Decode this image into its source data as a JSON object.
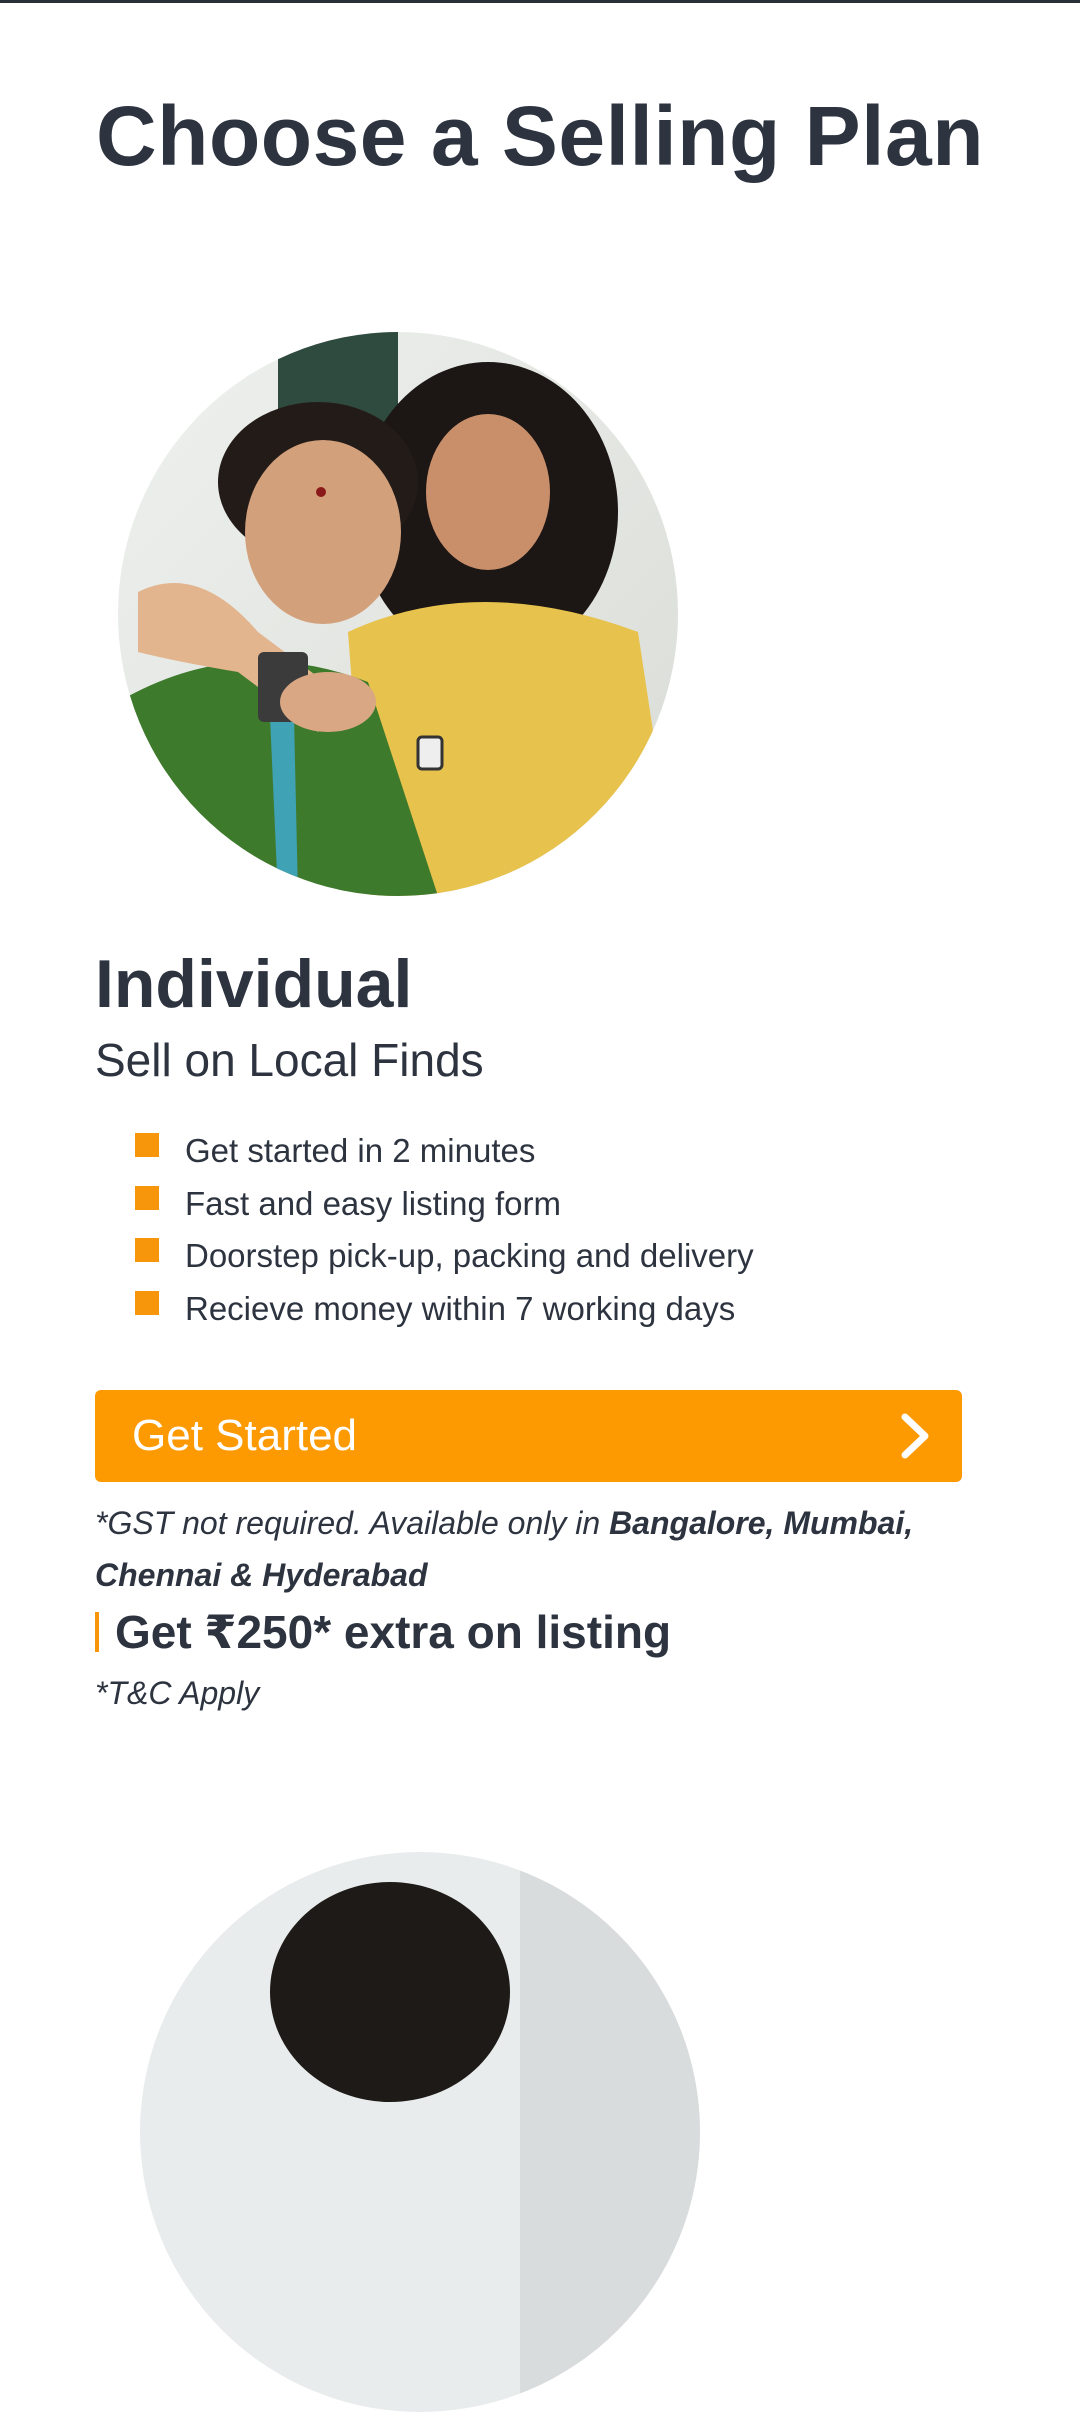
{
  "header": {
    "title": "Choose a Selling Plan"
  },
  "plan": {
    "title": "Individual",
    "subtitle": "Sell on Local Finds",
    "features": [
      "Get started in 2 minutes",
      "Fast and easy listing form",
      "Doorstep pick-up, packing and delivery",
      "Recieve money within 7 working days"
    ],
    "cta_label": "Get Started",
    "cta_icon": "chevron-right-icon",
    "note_prefix": "*GST not required. Available only in ",
    "note_cities": "Bangalore, Mumbai, Chennai & Hyderabad",
    "promo": "Get ₹250* extra on listing",
    "terms": "*T&C Apply"
  },
  "colors": {
    "accent": "#fd9a01",
    "bullet": "#f7950b",
    "text": "#2d3440",
    "background": "#ffffff"
  }
}
